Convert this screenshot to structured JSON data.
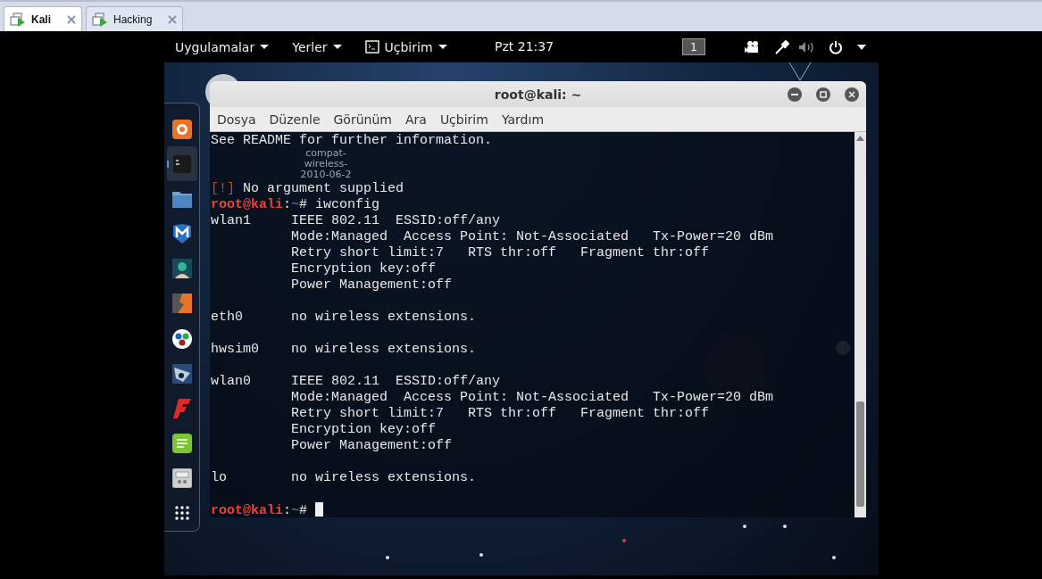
{
  "vm_tabs": [
    {
      "label": "Kali",
      "selected": true
    },
    {
      "label": "Hacking",
      "selected": false
    }
  ],
  "top_bar": {
    "menus": [
      "Uygulamalar",
      "Yerler",
      "Uçbirim"
    ],
    "clock": "Pzt 21:37",
    "workspace": "1"
  },
  "desktop_icon": {
    "label": "compat-wireless-2010-06-2"
  },
  "dock": [
    {
      "kind": "firefox",
      "selected": false
    },
    {
      "kind": "terminal",
      "selected": true
    },
    {
      "kind": "files",
      "selected": false
    },
    {
      "kind": "metasploit",
      "selected": false
    },
    {
      "kind": "armitage",
      "selected": false
    },
    {
      "kind": "burp",
      "selected": false
    },
    {
      "kind": "maltego",
      "selected": false
    },
    {
      "kind": "beef",
      "selected": false
    },
    {
      "kind": "faraday",
      "selected": false
    },
    {
      "kind": "leafpad",
      "selected": false
    },
    {
      "kind": "cherrytree",
      "selected": false
    },
    {
      "kind": "apps",
      "selected": false
    }
  ],
  "terminal": {
    "title": "root@kali: ~",
    "menu": [
      "Dosya",
      "Düzenle",
      "Görünüm",
      "Ara",
      "Uçbirim",
      "Yardım"
    ],
    "lines": [
      {
        "kind": "text",
        "segments": [
          {
            "kind": "plain",
            "text": "See README for further information."
          }
        ]
      },
      {
        "kind": "blank"
      },
      {
        "kind": "blank"
      },
      {
        "kind": "text",
        "segments": [
          {
            "kind": "warn",
            "text": "[!]"
          },
          {
            "kind": "plain",
            "text": " No argument supplied"
          }
        ]
      },
      {
        "kind": "text",
        "segments": [
          {
            "kind": "user",
            "text": "root@kali"
          },
          {
            "kind": "plain",
            "text": ":"
          },
          {
            "kind": "path",
            "text": "~"
          },
          {
            "kind": "plain",
            "text": "# iwconfig"
          }
        ]
      },
      {
        "kind": "text",
        "segments": [
          {
            "kind": "plain",
            "text": "wlan1     IEEE 802.11  ESSID:off/any"
          }
        ]
      },
      {
        "kind": "text",
        "segments": [
          {
            "kind": "plain",
            "text": "          Mode:Managed  Access Point: Not-Associated   Tx-Power=20 dBm"
          }
        ]
      },
      {
        "kind": "text",
        "segments": [
          {
            "kind": "plain",
            "text": "          Retry short limit:7   RTS thr:off   Fragment thr:off"
          }
        ]
      },
      {
        "kind": "text",
        "segments": [
          {
            "kind": "plain",
            "text": "          Encryption key:off"
          }
        ]
      },
      {
        "kind": "text",
        "segments": [
          {
            "kind": "plain",
            "text": "          Power Management:off"
          }
        ]
      },
      {
        "kind": "blank"
      },
      {
        "kind": "text",
        "segments": [
          {
            "kind": "plain",
            "text": "eth0      no wireless extensions."
          }
        ]
      },
      {
        "kind": "blank"
      },
      {
        "kind": "text",
        "segments": [
          {
            "kind": "plain",
            "text": "hwsim0    no wireless extensions."
          }
        ]
      },
      {
        "kind": "blank"
      },
      {
        "kind": "text",
        "segments": [
          {
            "kind": "plain",
            "text": "wlan0     IEEE 802.11  ESSID:off/any"
          }
        ]
      },
      {
        "kind": "text",
        "segments": [
          {
            "kind": "plain",
            "text": "          Mode:Managed  Access Point: Not-Associated   Tx-Power=20 dBm"
          }
        ]
      },
      {
        "kind": "text",
        "segments": [
          {
            "kind": "plain",
            "text": "          Retry short limit:7   RTS thr:off   Fragment thr:off"
          }
        ]
      },
      {
        "kind": "text",
        "segments": [
          {
            "kind": "plain",
            "text": "          Encryption key:off"
          }
        ]
      },
      {
        "kind": "text",
        "segments": [
          {
            "kind": "plain",
            "text": "          Power Management:off"
          }
        ]
      },
      {
        "kind": "blank"
      },
      {
        "kind": "text",
        "segments": [
          {
            "kind": "plain",
            "text": "lo        no wireless extensions."
          }
        ]
      },
      {
        "kind": "blank"
      },
      {
        "kind": "text",
        "segments": [
          {
            "kind": "user",
            "text": "root@kali"
          },
          {
            "kind": "plain",
            "text": ":"
          },
          {
            "kind": "path",
            "text": "~"
          },
          {
            "kind": "plain",
            "text": "# "
          }
        ],
        "cursor": true
      }
    ]
  }
}
